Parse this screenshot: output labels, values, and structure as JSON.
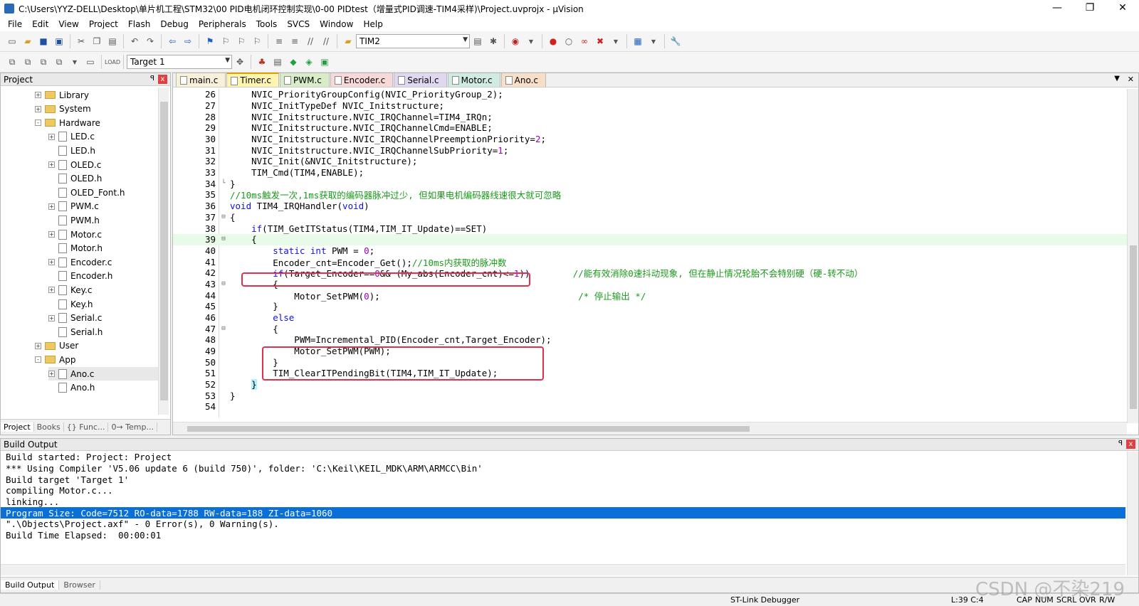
{
  "window": {
    "title": "C:\\Users\\YYZ-DELL\\Desktop\\单片机工程\\STM32\\00 PID电机闭环控制实现\\0-00  PIDtest（增量式PID调速-TIM4采样)\\Project.uvprojx - µVision",
    "min": "—",
    "max": "❐",
    "close": "✕"
  },
  "menu": [
    "File",
    "Edit",
    "View",
    "Project",
    "Flash",
    "Debug",
    "Peripherals",
    "Tools",
    "SVCS",
    "Window",
    "Help"
  ],
  "toolbar": {
    "find_value": "TIM2",
    "target_value": "Target 1"
  },
  "project_panel": {
    "title": "Project",
    "pin": "ꟼ",
    "close": "x",
    "tree": [
      {
        "label": "Library",
        "type": "folder",
        "indent": 1,
        "expand": "+"
      },
      {
        "label": "System",
        "type": "folder",
        "indent": 1,
        "expand": "+"
      },
      {
        "label": "Hardware",
        "type": "folder",
        "indent": 1,
        "expand": "-"
      },
      {
        "label": "LED.c",
        "type": "file",
        "indent": 2,
        "expand": "+"
      },
      {
        "label": "LED.h",
        "type": "file",
        "indent": 2,
        "expand": ""
      },
      {
        "label": "OLED.c",
        "type": "file",
        "indent": 2,
        "expand": "+"
      },
      {
        "label": "OLED.h",
        "type": "file",
        "indent": 2,
        "expand": ""
      },
      {
        "label": "OLED_Font.h",
        "type": "file",
        "indent": 2,
        "expand": ""
      },
      {
        "label": "PWM.c",
        "type": "file",
        "indent": 2,
        "expand": "+"
      },
      {
        "label": "PWM.h",
        "type": "file",
        "indent": 2,
        "expand": ""
      },
      {
        "label": "Motor.c",
        "type": "file",
        "indent": 2,
        "expand": "+"
      },
      {
        "label": "Motor.h",
        "type": "file",
        "indent": 2,
        "expand": ""
      },
      {
        "label": "Encoder.c",
        "type": "file",
        "indent": 2,
        "expand": "+"
      },
      {
        "label": "Encoder.h",
        "type": "file",
        "indent": 2,
        "expand": ""
      },
      {
        "label": "Key.c",
        "type": "file",
        "indent": 2,
        "expand": "+"
      },
      {
        "label": "Key.h",
        "type": "file",
        "indent": 2,
        "expand": ""
      },
      {
        "label": "Serial.c",
        "type": "file",
        "indent": 2,
        "expand": "+"
      },
      {
        "label": "Serial.h",
        "type": "file",
        "indent": 2,
        "expand": ""
      },
      {
        "label": "User",
        "type": "folder",
        "indent": 1,
        "expand": "+"
      },
      {
        "label": "App",
        "type": "folder",
        "indent": 1,
        "expand": "-"
      },
      {
        "label": "Ano.c",
        "type": "file",
        "indent": 2,
        "expand": "+",
        "selected": true
      },
      {
        "label": "Ano.h",
        "type": "file",
        "indent": 2,
        "expand": ""
      }
    ],
    "tabs": [
      "Project",
      "Books",
      "{} Func...",
      "0→ Temp..."
    ]
  },
  "editor": {
    "tabs": [
      {
        "label": "main.c",
        "color": "#f8f0d8"
      },
      {
        "label": "Timer.c",
        "color": "#fff3b0",
        "active": true
      },
      {
        "label": "PWM.c",
        "color": "#d8ecc8"
      },
      {
        "label": "Encoder.c",
        "color": "#f8d8d8"
      },
      {
        "label": "Serial.c",
        "color": "#e0d8f0"
      },
      {
        "label": "Motor.c",
        "color": "#d0ece0"
      },
      {
        "label": "Ano.c",
        "color": "#f8e0c8"
      }
    ],
    "lines": [
      {
        "n": "26",
        "fold": "",
        "html": "    NVIC_PriorityGroupConfig(NVIC_PriorityGroup_2);"
      },
      {
        "n": "27",
        "fold": "",
        "html": "    NVIC_InitTypeDef NVIC_Initstructure;"
      },
      {
        "n": "28",
        "fold": "",
        "html": "    NVIC_Initstructure.NVIC_IRQChannel=TIM4_IRQn;"
      },
      {
        "n": "29",
        "fold": "",
        "html": "    NVIC_Initstructure.NVIC_IRQChannelCmd=ENABLE;"
      },
      {
        "n": "30",
        "fold": "",
        "html": "    NVIC_Initstructure.NVIC_IRQChannelPreemptionPriority=<span class=num>2</span>;"
      },
      {
        "n": "31",
        "fold": "",
        "html": "    NVIC_Initstructure.NVIC_IRQChannelSubPriority=<span class=num>1</span>;"
      },
      {
        "n": "32",
        "fold": "",
        "html": "    NVIC_Init(&amp;NVIC_Initstructure);"
      },
      {
        "n": "33",
        "fold": "",
        "html": "    TIM_Cmd(TIM4,ENABLE);"
      },
      {
        "n": "34",
        "fold": "└",
        "html": "}"
      },
      {
        "n": "35",
        "fold": "",
        "html": "<span class=cmt>//10ms触发一次,1ms获取的编码器脉冲过少, 但如果电机编码器线速很大就可忽略</span>"
      },
      {
        "n": "36",
        "fold": "",
        "html": "<span class=kw>void</span> TIM4_IRQHandler(<span class=kw>void</span>)"
      },
      {
        "n": "37",
        "fold": "⊟",
        "html": "{"
      },
      {
        "n": "38",
        "fold": "",
        "html": "    <span class=kw>if</span>(TIM_GetITStatus(TIM4,TIM_IT_Update)==SET)"
      },
      {
        "n": "39",
        "fold": "⊟",
        "html": "    {",
        "current": true
      },
      {
        "n": "40",
        "fold": "",
        "html": "        <span class=kw>static</span> <span class=kw>int</span> PWM = <span class=num>0</span>;"
      },
      {
        "n": "41",
        "fold": "",
        "html": "        Encoder_cnt=Encoder_Get();<span class=cmt>//10ms内获取的脉冲数</span>"
      },
      {
        "n": "42",
        "fold": "",
        "html": "        <span class=kw>if</span>(Target_Encoder==<span class=num>0</span>&amp;&amp; (My_abs(Encoder_cnt)&lt;=<span class=num>1</span>))        <span class=cmt>//能有效消除0速抖动现象, 但在静止情况轮胎不会特别硬（硬-转不动）</span>"
      },
      {
        "n": "43",
        "fold": "⊟",
        "html": "        {"
      },
      {
        "n": "44",
        "fold": "",
        "html": "            Motor_SetPWM(<span class=num>0</span>);                                     <span class=cmt>/* 停止输出 */</span>"
      },
      {
        "n": "45",
        "fold": "",
        "html": "        }"
      },
      {
        "n": "46",
        "fold": "",
        "html": "        <span class=kw>else</span>"
      },
      {
        "n": "47",
        "fold": "⊟",
        "html": "        {"
      },
      {
        "n": "48",
        "fold": "",
        "html": "            PWM=Incremental_PID(Encoder_cnt,Target_Encoder);"
      },
      {
        "n": "49",
        "fold": "",
        "html": "            Motor_SetPWM(PWM);"
      },
      {
        "n": "50",
        "fold": "",
        "html": "        }"
      },
      {
        "n": "51",
        "fold": "",
        "html": "        TIM_ClearITPendingBit(TIM4,TIM_IT_Update);"
      },
      {
        "n": "52",
        "fold": "",
        "html": "    <span style='background:#b0f0ff'>}</span>"
      },
      {
        "n": "53",
        "fold": "",
        "html": "}"
      },
      {
        "n": "54",
        "fold": "",
        "html": ""
      }
    ]
  },
  "build_output": {
    "title": "Build Output",
    "lines": [
      {
        "text": "Build started: Project: Project"
      },
      {
        "text": "*** Using Compiler 'V5.06 update 6 (build 750)', folder: 'C:\\Keil\\KEIL_MDK\\ARM\\ARMCC\\Bin'"
      },
      {
        "text": "Build target 'Target 1'"
      },
      {
        "text": "compiling Motor.c..."
      },
      {
        "text": "linking..."
      },
      {
        "text": "Program Size: Code=7512 RO-data=1788 RW-data=188 ZI-data=1060",
        "highlight": true
      },
      {
        "text": "\".\\Objects\\Project.axf\" - 0 Error(s), 0 Warning(s)."
      },
      {
        "text": "Build Time Elapsed:  00:00:01"
      }
    ],
    "tabs": [
      "Build Output",
      "Browser"
    ]
  },
  "status": {
    "debugger": "ST-Link Debugger",
    "position": "L:39 C:4",
    "cap": "CAP",
    "num": "NUM",
    "scrl": "SCRL",
    "ovr": "OVR",
    "rw": "R/W"
  },
  "watermark": "CSDN @不染219"
}
